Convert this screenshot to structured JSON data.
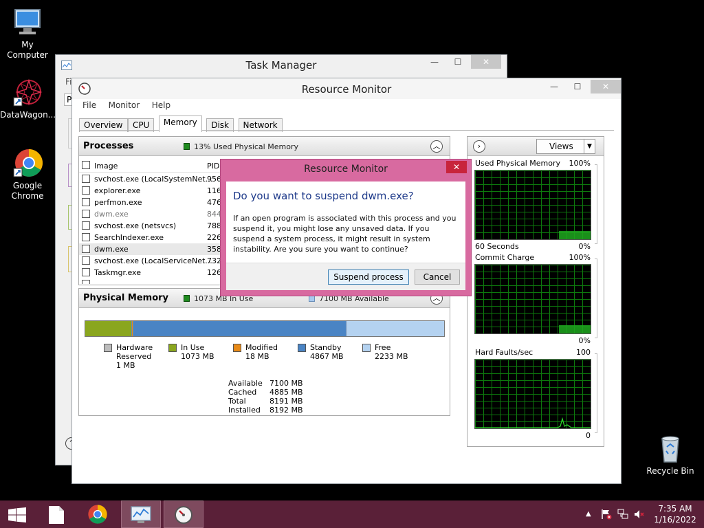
{
  "desktop": {
    "icons": [
      {
        "label": "My Computer"
      },
      {
        "label": "DataWagon..."
      },
      {
        "label": "Google Chrome"
      },
      {
        "label": "Recycle Bin"
      }
    ]
  },
  "task_manager": {
    "title": "Task Manager",
    "menu_partial": "Fi",
    "tab_partial": "Pr"
  },
  "resource_monitor": {
    "title": "Resource Monitor",
    "menu": [
      "File",
      "Monitor",
      "Help"
    ],
    "tabs": [
      "Overview",
      "CPU",
      "Memory",
      "Disk",
      "Network"
    ],
    "active_tab": "Memory",
    "processes": {
      "title": "Processes",
      "status": "13% Used Physical Memory",
      "columns": {
        "image": "Image",
        "pid": "PID"
      },
      "rows": [
        {
          "image": "svchost.exe (LocalSystemNet...",
          "pid": "956",
          "dim": false
        },
        {
          "image": "explorer.exe",
          "pid": "1164",
          "dim": false
        },
        {
          "image": "perfmon.exe",
          "pid": "4760",
          "dim": false
        },
        {
          "image": "dwm.exe",
          "pid": "844",
          "dim": true
        },
        {
          "image": "svchost.exe (netsvcs)",
          "pid": "788",
          "dim": false
        },
        {
          "image": "SearchIndexer.exe",
          "pid": "2268",
          "dim": false
        },
        {
          "image": "dwm.exe",
          "pid": "3584",
          "dim": false
        },
        {
          "image": "svchost.exe (LocalServiceNet...",
          "pid": "732",
          "dim": false
        },
        {
          "image": "Taskmgr.exe",
          "pid": "1260",
          "dim": false
        }
      ]
    },
    "physical_memory": {
      "title": "Physical Memory",
      "in_use": "1073 MB In Use",
      "available": "7100 MB Available",
      "bar": {
        "hardware_reserved": 1,
        "in_use": 1073,
        "modified": 18,
        "standby": 4867,
        "free": 2233,
        "total": 8192
      },
      "legend": [
        {
          "name": "Hardware Reserved",
          "value": "1 MB",
          "color": "#bdbdbd"
        },
        {
          "name": "In Use",
          "value": "1073 MB",
          "color": "#8aa61e"
        },
        {
          "name": "Modified",
          "value": "18 MB",
          "color": "#e88a17"
        },
        {
          "name": "Standby",
          "value": "4867 MB",
          "color": "#4a84c4"
        },
        {
          "name": "Free",
          "value": "2233 MB",
          "color": "#b4d2f0"
        }
      ],
      "stats": [
        {
          "label": "Available",
          "value": "7100 MB"
        },
        {
          "label": "Cached",
          "value": "4885 MB"
        },
        {
          "label": "Total",
          "value": "8191 MB"
        },
        {
          "label": "Installed",
          "value": "8192 MB"
        }
      ]
    },
    "side": {
      "views_label": "Views",
      "graphs": [
        {
          "title": "Used Physical Memory",
          "max": "100%",
          "bottom_left": "60 Seconds",
          "bottom_right": "0%"
        },
        {
          "title": "Commit Charge",
          "max": "100%",
          "bottom_left": "",
          "bottom_right": "0%"
        },
        {
          "title": "Hard Faults/sec",
          "max": "100",
          "bottom_left": "",
          "bottom_right": "0"
        }
      ]
    }
  },
  "dialog": {
    "title": "Resource Monitor",
    "heading": "Do you want to suspend dwm.exe?",
    "body": "If an open program is associated with this process and you suspend it, you might lose any unsaved data. If you suspend a system process, it might result in system instability. Are you sure you want to continue?",
    "primary": "Suspend process",
    "cancel": "Cancel"
  },
  "taskbar": {
    "time": "7:35 AM",
    "date": "1/16/2022"
  },
  "colors": {
    "taskbar": "#5a2038",
    "dialog_frame": "#d86aa0",
    "graph_green": "#1ea81e"
  }
}
